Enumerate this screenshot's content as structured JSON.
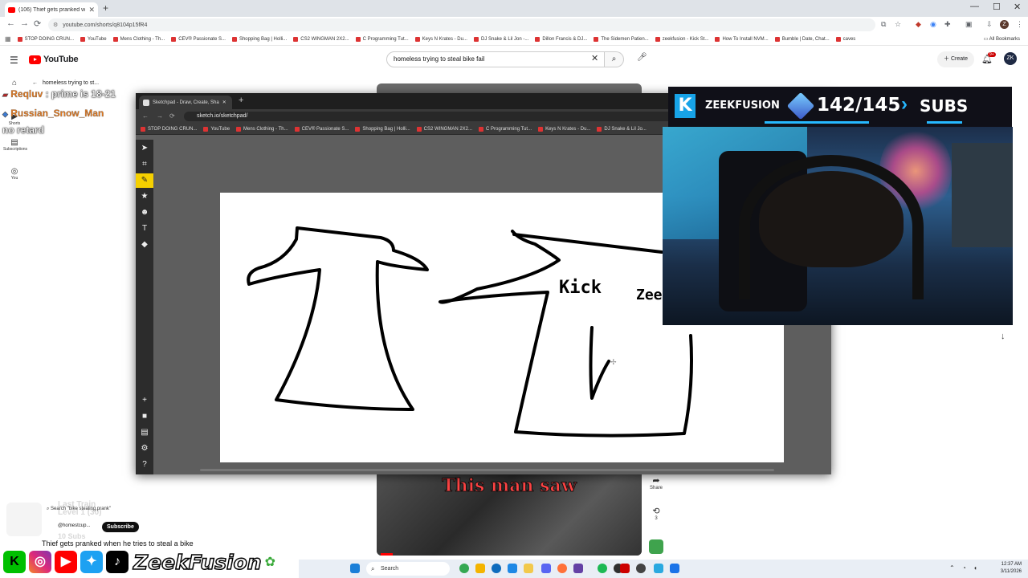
{
  "browser": {
    "tab_title": "(106) Thief gets pranked when",
    "url": "youtube.com/shorts/q8104p15fR4",
    "profile_initial": "Z",
    "bookmarks": [
      "STOP DOING CRUN...",
      "YouTube",
      "Mens Clothing - Th...",
      "CEV® Passionate S...",
      "Shopping Bag | Holli...",
      "CS2 WINGMAN 2X2...",
      "C Programming Tut...",
      "Keys N Krates - Du...",
      "DJ Snake & Lil Jon -...",
      "Dillon Francis & DJ...",
      "The Sidemen Patien...",
      "zeekfusion - Kick St...",
      "How To Install NVM...",
      "Bumble | Date, Chat...",
      "caves"
    ],
    "all_bookmarks": "All Bookmarks"
  },
  "youtube": {
    "logo_text": "YouTube",
    "search_value": "homeless trying to steal bike fail",
    "create_label": "Create",
    "notif_count": "9+",
    "avatar_initial": "ZK",
    "sidebar": [
      {
        "icon": "home-icon",
        "label": ""
      },
      {
        "icon": "shorts-icon",
        "label": "Shorts"
      },
      {
        "icon": "subscriptions-icon",
        "label": "Subscriptions"
      },
      {
        "icon": "you-icon",
        "label": "You"
      }
    ],
    "back_label": "homeless trying to st...",
    "caption": "This man saw",
    "share_label": "Share",
    "remix_count": "3",
    "mini_search": "Search \"bike stealing prank\"",
    "channel_name": "@homestcup...",
    "subscribe_label": "Subscribe",
    "video_title": "Thief gets pranked when he tries to steal a bike"
  },
  "chat": [
    {
      "user": "Reqluv",
      "message": " : prime is 18-21"
    },
    {
      "user": "Russian_Snow_Man",
      "message": ""
    },
    {
      "user": "",
      "message": "no retard"
    }
  ],
  "stream_overlay": {
    "last_train": "Last Train",
    "level": "Level 1  (30)",
    "subs_small": "10 Subs",
    "brand_name": "ZeekFusion",
    "sub_goal": {
      "channel": "ZEEKFUSION",
      "current": 142,
      "target": 145,
      "label": "SUBS",
      "display": "142/145"
    }
  },
  "sketchpad": {
    "tab_title": "Sketchpad - Draw, Create, Sha",
    "url": "sketch.io/sketchpad/",
    "bookmarks": [
      "STOP DOING CRUN...",
      "YouTube",
      "Mens Clothing - Th...",
      "CEV® Passionate S...",
      "Shopping Bag | Holli...",
      "CS2 WINGMAN 2X2...",
      "C Programming Tut...",
      "Keys N Krates - Du...",
      "DJ Snake & Lil Jo..."
    ],
    "tools": [
      "select-tool",
      "crop-tool",
      "brush-tool",
      "stamp-tool",
      "emoji-tool",
      "text-tool",
      "fill-tool"
    ],
    "bottom_tools": [
      "add-tool",
      "layers-tool",
      "save-tool",
      "settings-tool",
      "help-tool"
    ],
    "drawing_text_1": "Kick",
    "drawing_text_2": "Zee"
  },
  "taskbar": {
    "search_placeholder": "Search",
    "time": "12:37 AM",
    "date": "3/11/2026"
  }
}
